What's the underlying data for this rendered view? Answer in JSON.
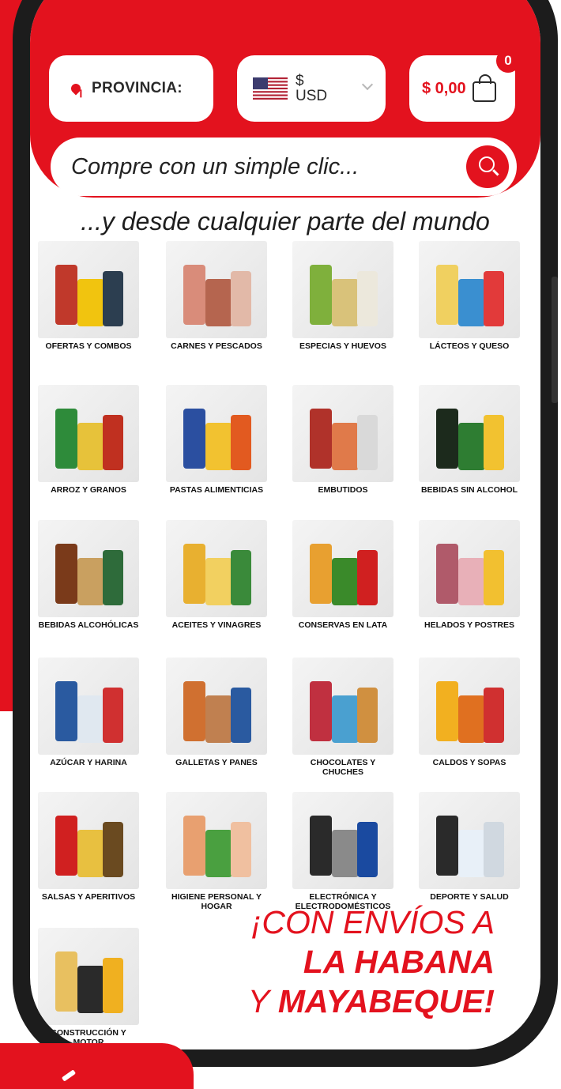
{
  "header": {
    "province_label": "PROVINCIA:",
    "currency_symbol": "$",
    "currency_code": "USD",
    "cart_amount": "$ 0,00",
    "cart_count": "0",
    "search_placeholder": "Compre con un simple clic...",
    "tagline": "...y desde cualquier parte del mundo"
  },
  "categories": [
    {
      "label": "OFERTAS Y COMBOS",
      "icon": "offers-combos-image"
    },
    {
      "label": "CARNES Y PESCADOS",
      "icon": "meat-fish-image"
    },
    {
      "label": "ESPECIAS Y HUEVOS",
      "icon": "spices-eggs-image"
    },
    {
      "label": "LÁCTEOS Y QUESO",
      "icon": "dairy-cheese-image"
    },
    {
      "label": "ARROZ Y GRANOS",
      "icon": "rice-grains-image"
    },
    {
      "label": "PASTAS ALIMENTICIAS",
      "icon": "pasta-image"
    },
    {
      "label": "EMBUTIDOS",
      "icon": "cold-cuts-image"
    },
    {
      "label": "BEBIDAS SIN ALCOHOL",
      "icon": "soft-drinks-image"
    },
    {
      "label": "BEBIDAS ALCOHÓLICAS",
      "icon": "alcohol-image"
    },
    {
      "label": "ACEITES Y VINAGRES",
      "icon": "oil-vinegar-image"
    },
    {
      "label": "CONSERVAS EN LATA",
      "icon": "canned-goods-image"
    },
    {
      "label": "HELADOS Y POSTRES",
      "icon": "ice-cream-desserts-image"
    },
    {
      "label": "AZÚCAR Y HARINA",
      "icon": "sugar-flour-image"
    },
    {
      "label": "GALLETAS Y PANES",
      "icon": "cookies-bread-image"
    },
    {
      "label": "CHOCOLATES Y CHUCHES",
      "icon": "chocolates-sweets-image"
    },
    {
      "label": "CALDOS Y SOPAS",
      "icon": "broth-soups-image"
    },
    {
      "label": "SALSAS Y APERITIVOS",
      "icon": "sauces-snacks-image"
    },
    {
      "label": "HIGIENE PERSONAL Y HOGAR",
      "icon": "hygiene-home-image"
    },
    {
      "label": "ELECTRÓNICA Y ELECTRODOMÉSTICOS",
      "icon": "electronics-appliances-image"
    },
    {
      "label": "DEPORTE Y SALUD",
      "icon": "sport-health-image"
    },
    {
      "label": "CONSTRUCCIÓN Y MOTOR",
      "icon": "construction-motor-image"
    }
  ],
  "promo": {
    "line1": "¡CON ENVÍOS A",
    "line2": "LA HABANA",
    "line3_prefix": "Y ",
    "line3_strong": "MAYABEQUE!"
  },
  "colors": {
    "accent": "#e3121e",
    "phone_frame": "#1c1c1c"
  }
}
